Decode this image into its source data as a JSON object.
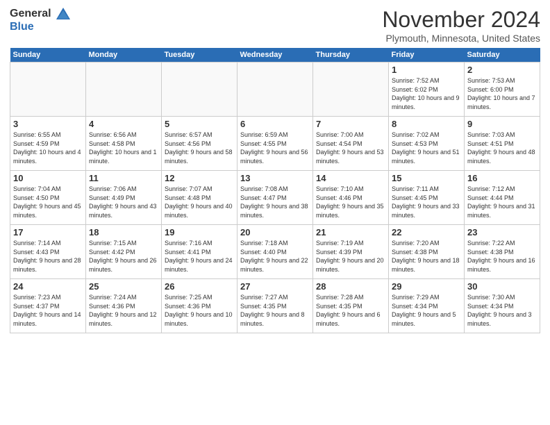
{
  "header": {
    "logo_line1": "General",
    "logo_line2": "Blue",
    "month_title": "November 2024",
    "location": "Plymouth, Minnesota, United States"
  },
  "days_of_week": [
    "Sunday",
    "Monday",
    "Tuesday",
    "Wednesday",
    "Thursday",
    "Friday",
    "Saturday"
  ],
  "weeks": [
    [
      {
        "day": "",
        "info": ""
      },
      {
        "day": "",
        "info": ""
      },
      {
        "day": "",
        "info": ""
      },
      {
        "day": "",
        "info": ""
      },
      {
        "day": "",
        "info": ""
      },
      {
        "day": "1",
        "info": "Sunrise: 7:52 AM\nSunset: 6:02 PM\nDaylight: 10 hours and 9 minutes."
      },
      {
        "day": "2",
        "info": "Sunrise: 7:53 AM\nSunset: 6:00 PM\nDaylight: 10 hours and 7 minutes."
      }
    ],
    [
      {
        "day": "3",
        "info": "Sunrise: 6:55 AM\nSunset: 4:59 PM\nDaylight: 10 hours and 4 minutes."
      },
      {
        "day": "4",
        "info": "Sunrise: 6:56 AM\nSunset: 4:58 PM\nDaylight: 10 hours and 1 minute."
      },
      {
        "day": "5",
        "info": "Sunrise: 6:57 AM\nSunset: 4:56 PM\nDaylight: 9 hours and 58 minutes."
      },
      {
        "day": "6",
        "info": "Sunrise: 6:59 AM\nSunset: 4:55 PM\nDaylight: 9 hours and 56 minutes."
      },
      {
        "day": "7",
        "info": "Sunrise: 7:00 AM\nSunset: 4:54 PM\nDaylight: 9 hours and 53 minutes."
      },
      {
        "day": "8",
        "info": "Sunrise: 7:02 AM\nSunset: 4:53 PM\nDaylight: 9 hours and 51 minutes."
      },
      {
        "day": "9",
        "info": "Sunrise: 7:03 AM\nSunset: 4:51 PM\nDaylight: 9 hours and 48 minutes."
      }
    ],
    [
      {
        "day": "10",
        "info": "Sunrise: 7:04 AM\nSunset: 4:50 PM\nDaylight: 9 hours and 45 minutes."
      },
      {
        "day": "11",
        "info": "Sunrise: 7:06 AM\nSunset: 4:49 PM\nDaylight: 9 hours and 43 minutes."
      },
      {
        "day": "12",
        "info": "Sunrise: 7:07 AM\nSunset: 4:48 PM\nDaylight: 9 hours and 40 minutes."
      },
      {
        "day": "13",
        "info": "Sunrise: 7:08 AM\nSunset: 4:47 PM\nDaylight: 9 hours and 38 minutes."
      },
      {
        "day": "14",
        "info": "Sunrise: 7:10 AM\nSunset: 4:46 PM\nDaylight: 9 hours and 35 minutes."
      },
      {
        "day": "15",
        "info": "Sunrise: 7:11 AM\nSunset: 4:45 PM\nDaylight: 9 hours and 33 minutes."
      },
      {
        "day": "16",
        "info": "Sunrise: 7:12 AM\nSunset: 4:44 PM\nDaylight: 9 hours and 31 minutes."
      }
    ],
    [
      {
        "day": "17",
        "info": "Sunrise: 7:14 AM\nSunset: 4:43 PM\nDaylight: 9 hours and 28 minutes."
      },
      {
        "day": "18",
        "info": "Sunrise: 7:15 AM\nSunset: 4:42 PM\nDaylight: 9 hours and 26 minutes."
      },
      {
        "day": "19",
        "info": "Sunrise: 7:16 AM\nSunset: 4:41 PM\nDaylight: 9 hours and 24 minutes."
      },
      {
        "day": "20",
        "info": "Sunrise: 7:18 AM\nSunset: 4:40 PM\nDaylight: 9 hours and 22 minutes."
      },
      {
        "day": "21",
        "info": "Sunrise: 7:19 AM\nSunset: 4:39 PM\nDaylight: 9 hours and 20 minutes."
      },
      {
        "day": "22",
        "info": "Sunrise: 7:20 AM\nSunset: 4:38 PM\nDaylight: 9 hours and 18 minutes."
      },
      {
        "day": "23",
        "info": "Sunrise: 7:22 AM\nSunset: 4:38 PM\nDaylight: 9 hours and 16 minutes."
      }
    ],
    [
      {
        "day": "24",
        "info": "Sunrise: 7:23 AM\nSunset: 4:37 PM\nDaylight: 9 hours and 14 minutes."
      },
      {
        "day": "25",
        "info": "Sunrise: 7:24 AM\nSunset: 4:36 PM\nDaylight: 9 hours and 12 minutes."
      },
      {
        "day": "26",
        "info": "Sunrise: 7:25 AM\nSunset: 4:36 PM\nDaylight: 9 hours and 10 minutes."
      },
      {
        "day": "27",
        "info": "Sunrise: 7:27 AM\nSunset: 4:35 PM\nDaylight: 9 hours and 8 minutes."
      },
      {
        "day": "28",
        "info": "Sunrise: 7:28 AM\nSunset: 4:35 PM\nDaylight: 9 hours and 6 minutes."
      },
      {
        "day": "29",
        "info": "Sunrise: 7:29 AM\nSunset: 4:34 PM\nDaylight: 9 hours and 5 minutes."
      },
      {
        "day": "30",
        "info": "Sunrise: 7:30 AM\nSunset: 4:34 PM\nDaylight: 9 hours and 3 minutes."
      }
    ]
  ]
}
